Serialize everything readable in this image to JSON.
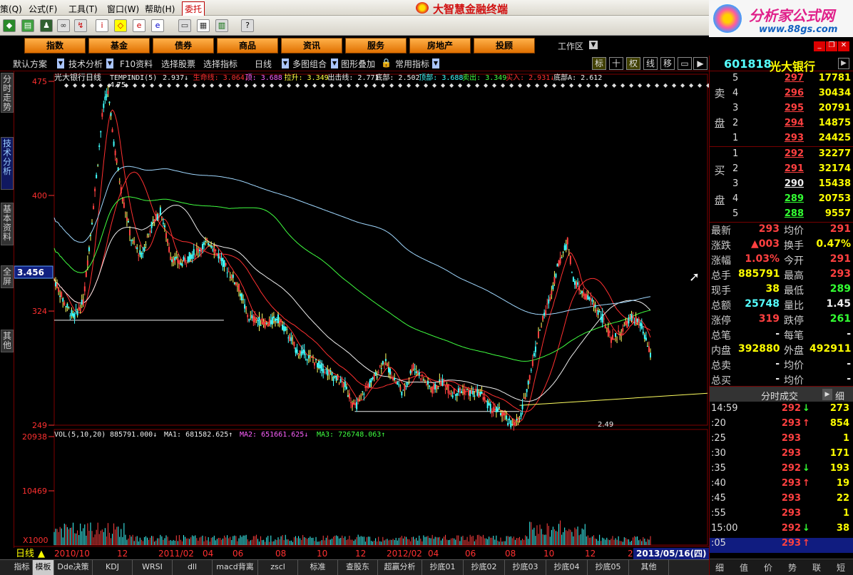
{
  "menubar": {
    "items": [
      "策(Q)",
      "公式(F)",
      "工具(T)",
      "窗口(W)",
      "帮助(H)"
    ],
    "entrust": "委托",
    "app_title": "大智慧金融终端"
  },
  "brand": {
    "name": "分析家公式网",
    "url": "www.88gs.com"
  },
  "categories": [
    "指数",
    "基金",
    "债券",
    "商品",
    "资讯",
    "服务",
    "房地产",
    "投顾"
  ],
  "workarea": "工作区",
  "chart_toolbar": {
    "items": [
      "默认方案",
      "技术分析",
      "F10资料",
      "选择股票",
      "选择指标",
      "日线",
      "多图组合",
      "图形叠加",
      "常用指标"
    ],
    "right_buttons": [
      "标",
      "十",
      "权",
      "线",
      "移"
    ]
  },
  "side_tabs": [
    "分时走势",
    "技术分析",
    "基本资料",
    "全屏",
    "其他"
  ],
  "indicator_line": {
    "prefix": "光大银行日线",
    "name": "TEMPINDI(5)",
    "items": [
      {
        "label": "",
        "value": "2.937↓",
        "color": "#eeeeee"
      },
      {
        "label": "生命线:",
        "value": "3.064↓",
        "color": "#ff3030"
      },
      {
        "label": "顶:",
        "value": "3.688",
        "color": "#ff60ff"
      },
      {
        "label": "拉升:",
        "value": "3.349",
        "color": "#ffff40"
      },
      {
        "label": "出击线:",
        "value": "2.771",
        "color": "#eeeeee"
      },
      {
        "label": "底部:",
        "value": "2.502",
        "color": "#eeeeee"
      },
      {
        "label": "顶部:",
        "value": "3.688",
        "color": "#40ffff"
      },
      {
        "label": "卖出:",
        "value": "3.349",
        "color": "#40ff40"
      },
      {
        "label": "买入:",
        "value": "2.931↓",
        "color": "#ff3030"
      },
      {
        "label": "底部A:",
        "value": "2.612",
        "color": "#eeeeee"
      }
    ]
  },
  "vol_line": {
    "name": "VOL(5,10,20)",
    "vol": "885791.000↓",
    "ma1": "MA1: 681582.625↑",
    "ma2": "MA2: 651661.625↓",
    "ma3": "MA3: 726748.063↑"
  },
  "chart_labels": {
    "high_mark": "4.75",
    "low_mark": "2.49",
    "cursor_value": "3.456",
    "vol_unit": "X1000",
    "period": "日线",
    "date_badge": "2013/05/16(四)"
  },
  "chart_data": {
    "type": "line",
    "price_axis": [
      "475",
      "400",
      "324",
      "249"
    ],
    "price_ylim": [
      249,
      475
    ],
    "volume_axis": [
      "20938",
      "10469"
    ],
    "volume_ylim": [
      0,
      20938
    ],
    "x_labels": [
      "2010/10",
      "12",
      "2011/02",
      "04",
      "06",
      "08",
      "10",
      "12",
      "2012/02",
      "04",
      "06",
      "08",
      "10",
      "12",
      "2"
    ],
    "price_path": [
      [
        0,
        3.45
      ],
      [
        4,
        3.3
      ],
      [
        8,
        3.2
      ],
      [
        12,
        3.3
      ],
      [
        16,
        3.9
      ],
      [
        20,
        4.55
      ],
      [
        22,
        4.7
      ],
      [
        25,
        4.3
      ],
      [
        28,
        4.0
      ],
      [
        32,
        3.7
      ],
      [
        36,
        3.6
      ],
      [
        40,
        3.8
      ],
      [
        44,
        3.9
      ],
      [
        48,
        3.6
      ],
      [
        52,
        3.55
      ],
      [
        56,
        3.6
      ],
      [
        60,
        3.65
      ],
      [
        64,
        3.7
      ],
      [
        68,
        3.6
      ],
      [
        72,
        3.5
      ],
      [
        76,
        3.4
      ],
      [
        80,
        3.2
      ],
      [
        84,
        3.18
      ],
      [
        88,
        3.15
      ],
      [
        92,
        3.2
      ],
      [
        96,
        3.1
      ],
      [
        100,
        2.98
      ],
      [
        104,
        2.95
      ],
      [
        108,
        2.9
      ],
      [
        112,
        2.85
      ],
      [
        116,
        2.8
      ],
      [
        120,
        2.75
      ],
      [
        124,
        2.6
      ],
      [
        128,
        2.72
      ],
      [
        132,
        2.8
      ],
      [
        136,
        2.92
      ],
      [
        140,
        2.8
      ],
      [
        144,
        2.7
      ],
      [
        148,
        2.88
      ],
      [
        152,
        2.8
      ],
      [
        156,
        2.72
      ],
      [
        160,
        2.78
      ],
      [
        164,
        2.7
      ],
      [
        168,
        2.72
      ],
      [
        172,
        2.7
      ],
      [
        176,
        2.7
      ],
      [
        180,
        2.6
      ],
      [
        184,
        2.58
      ],
      [
        188,
        2.5
      ],
      [
        192,
        2.52
      ],
      [
        196,
        2.8
      ],
      [
        200,
        3.1
      ],
      [
        204,
        3.3
      ],
      [
        208,
        3.55
      ],
      [
        212,
        3.7
      ],
      [
        214,
        3.45
      ],
      [
        218,
        3.35
      ],
      [
        222,
        3.3
      ],
      [
        226,
        3.2
      ],
      [
        230,
        3.05
      ],
      [
        234,
        3.1
      ],
      [
        238,
        3.2
      ],
      [
        242,
        3.15
      ],
      [
        246,
        2.95
      ]
    ]
  },
  "quote": {
    "code": "601818",
    "name": "光大银行",
    "sell_label": [
      "卖",
      "盘"
    ],
    "buy_label": [
      "买",
      "盘"
    ],
    "asks": [
      {
        "level": "5",
        "price": "297",
        "qty": "17781"
      },
      {
        "level": "4",
        "price": "296",
        "qty": "30434"
      },
      {
        "level": "3",
        "price": "295",
        "qty": "20791"
      },
      {
        "level": "2",
        "price": "294",
        "qty": "14875"
      },
      {
        "level": "1",
        "price": "293",
        "qty": "24425"
      }
    ],
    "bids": [
      {
        "level": "1",
        "price": "292",
        "qty": "32277"
      },
      {
        "level": "2",
        "price": "291",
        "qty": "32174"
      },
      {
        "level": "3",
        "price": "290",
        "qty": "15438"
      },
      {
        "level": "4",
        "price": "289",
        "qty": "20753"
      },
      {
        "level": "5",
        "price": "288",
        "qty": "9557"
      }
    ],
    "stats": [
      {
        "l1": "最新",
        "v1": "293",
        "c1": "red",
        "l2": "均价",
        "v2": "291",
        "c2": "red"
      },
      {
        "l1": "涨跌",
        "v1": "▲003",
        "c1": "red",
        "l2": "换手",
        "v2": "0.47%",
        "c2": "yellow"
      },
      {
        "l1": "涨幅",
        "v1": "1.03%",
        "c1": "red",
        "l2": "今开",
        "v2": "291",
        "c2": "red"
      },
      {
        "l1": "总手",
        "v1": "885791",
        "c1": "yellow",
        "l2": "最高",
        "v2": "293",
        "c2": "red"
      },
      {
        "l1": "现手",
        "v1": "38",
        "c1": "yellow",
        "l2": "最低",
        "v2": "289",
        "c2": "green"
      },
      {
        "l1": "总额",
        "v1": "25748",
        "c1": "cyan",
        "l2": "量比",
        "v2": "1.45",
        "c2": "white"
      },
      {
        "l1": "涨停",
        "v1": "319",
        "c1": "red",
        "l2": "跌停",
        "v2": "261",
        "c2": "green"
      },
      {
        "l1": "总笔",
        "v1": "-",
        "c1": "white",
        "l2": "每笔",
        "v2": "-",
        "c2": "white"
      },
      {
        "l1": "内盘",
        "v1": "392880",
        "c1": "yellow",
        "l2": "外盘",
        "v2": "492911",
        "c2": "yellow"
      },
      {
        "l1": "总卖",
        "v1": "-",
        "c1": "white",
        "l2": "均价",
        "v2": "-",
        "c2": "white"
      },
      {
        "l1": "总买",
        "v1": "-",
        "c1": "white",
        "l2": "均价",
        "v2": "-",
        "c2": "white"
      }
    ]
  },
  "trades": {
    "title": "分时成交",
    "detail_btn": "细",
    "rows": [
      {
        "time": "14:59",
        "price": "292",
        "dir": "↓",
        "c": "green",
        "vol": "273"
      },
      {
        "time": ":20",
        "price": "293",
        "dir": "↑",
        "c": "red",
        "vol": "854"
      },
      {
        "time": ":25",
        "price": "293",
        "dir": "",
        "c": "red",
        "vol": "1"
      },
      {
        "time": ":30",
        "price": "293",
        "dir": "",
        "c": "red",
        "vol": "171"
      },
      {
        "time": ":35",
        "price": "292",
        "dir": "↓",
        "c": "green",
        "vol": "193"
      },
      {
        "time": ":40",
        "price": "293",
        "dir": "↑",
        "c": "red",
        "vol": "19"
      },
      {
        "time": ":45",
        "price": "293",
        "dir": "",
        "c": "red",
        "vol": "22"
      },
      {
        "time": ":55",
        "price": "293",
        "dir": "",
        "c": "red",
        "vol": "1"
      },
      {
        "time": "15:00",
        "price": "292",
        "dir": "↓",
        "c": "green",
        "vol": "38"
      },
      {
        "time": ":05",
        "price": "293",
        "dir": "↑",
        "c": "red",
        "vol": ""
      }
    ]
  },
  "rp_bottom_tabs": [
    "细",
    "值",
    "价",
    "势",
    "联",
    "短"
  ],
  "bottom_tabs": [
    "指标",
    "模板",
    "Dde决策",
    "KDJ",
    "WRSI",
    "dll",
    "macd背离",
    "zscl",
    "标准",
    "查股东",
    "超赢分析",
    "抄底01",
    "抄底02",
    "抄底03",
    "抄底04",
    "抄底05",
    "其他"
  ]
}
